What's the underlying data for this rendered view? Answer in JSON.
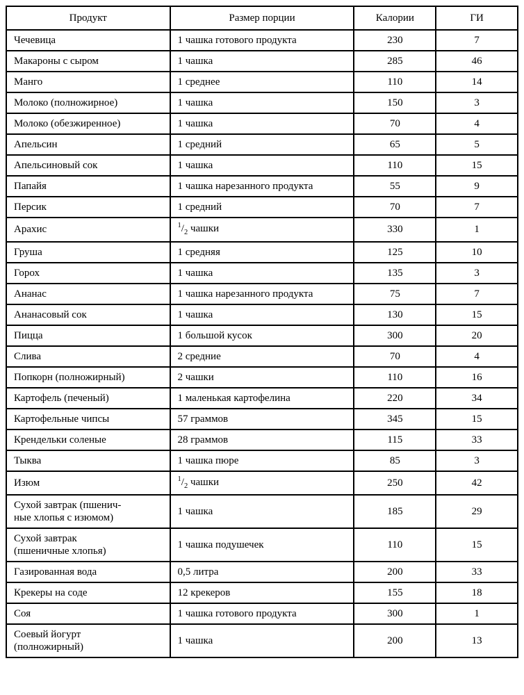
{
  "chart_data": {
    "type": "table",
    "headers": [
      "Продукт",
      "Размер порции",
      "Калории",
      "ГИ"
    ],
    "rows": [
      {
        "product": "Чечевица",
        "portion": "1 чашка готового продукта",
        "calories": "230",
        "gi": "7"
      },
      {
        "product": "Макароны с сыром",
        "portion": "1 чашка",
        "calories": "285",
        "gi": "46"
      },
      {
        "product": "Манго",
        "portion": "1 среднее",
        "calories": "110",
        "gi": "14"
      },
      {
        "product": "Молоко (полножирное)",
        "portion": "1 чашка",
        "calories": "150",
        "gi": "3"
      },
      {
        "product": "Молоко (обезжиренное)",
        "portion": "1 чашка",
        "calories": "70",
        "gi": "4"
      },
      {
        "product": "Апельсин",
        "portion": "1 средний",
        "calories": "65",
        "gi": "5"
      },
      {
        "product": "Апельсиновый сок",
        "portion": "1 чашка",
        "calories": "110",
        "gi": "15"
      },
      {
        "product": "Папайя",
        "portion": "1 чашка нарезанного продукта",
        "calories": "55",
        "gi": "9"
      },
      {
        "product": "Персик",
        "portion": "1 средний",
        "calories": "70",
        "gi": "7"
      },
      {
        "product": "Арахис",
        "portion_html": "<sup>1</sup>/<sub>2</sub> чашки",
        "calories": "330",
        "gi": "1"
      },
      {
        "product": "Груша",
        "portion": "1 средняя",
        "calories": "125",
        "gi": "10"
      },
      {
        "product": "Горох",
        "portion": "1 чашка",
        "calories": "135",
        "gi": "3"
      },
      {
        "product": "Ананас",
        "portion": "1 чашка нарезанного продукта",
        "calories": "75",
        "gi": "7"
      },
      {
        "product": "Ананасовый сок",
        "portion": "1 чашка",
        "calories": "130",
        "gi": "15"
      },
      {
        "product": "Пицца",
        "portion": "1 большой кусок",
        "calories": "300",
        "gi": "20"
      },
      {
        "product": "Слива",
        "portion": "2 средние",
        "calories": "70",
        "gi": "4"
      },
      {
        "product": "Попкорн (полножирный)",
        "portion": "2 чашки",
        "calories": "110",
        "gi": "16"
      },
      {
        "product": "Картофель (печеный)",
        "portion": "1 маленькая картофелина",
        "calories": "220",
        "gi": "34"
      },
      {
        "product": "Картофельные чипсы",
        "portion": "57 граммов",
        "calories": "345",
        "gi": "15"
      },
      {
        "product": "Крендельки соленые",
        "portion": "28 граммов",
        "calories": "115",
        "gi": "33"
      },
      {
        "product": "Тыква",
        "portion": "1 чашка пюре",
        "calories": "85",
        "gi": "3"
      },
      {
        "product": "Изюм",
        "portion_html": "<sup>1</sup>/<sub>2</sub> чашки",
        "calories": "250",
        "gi": "42"
      },
      {
        "product_html": "Сухой завтрак (пшенич-<br>ные хлопья с изюмом)",
        "portion": "1 чашка",
        "calories": "185",
        "gi": "29"
      },
      {
        "product_html": "Сухой завтрак<br>(пшеничные хлопья)",
        "portion": "1 чашка подушечек",
        "calories": "110",
        "gi": "15"
      },
      {
        "product": "Газированная вода",
        "portion": "0,5 литра",
        "calories": "200",
        "gi": "33"
      },
      {
        "product": "Крекеры на соде",
        "portion": "12 крекеров",
        "calories": "155",
        "gi": "18"
      },
      {
        "product": "Соя",
        "portion": "1 чашка готового продукта",
        "calories": "300",
        "gi": "1"
      },
      {
        "product_html": "Соевый йогурт<br>(полножирный)",
        "portion": "1 чашка",
        "calories": "200",
        "gi": "13"
      }
    ]
  }
}
